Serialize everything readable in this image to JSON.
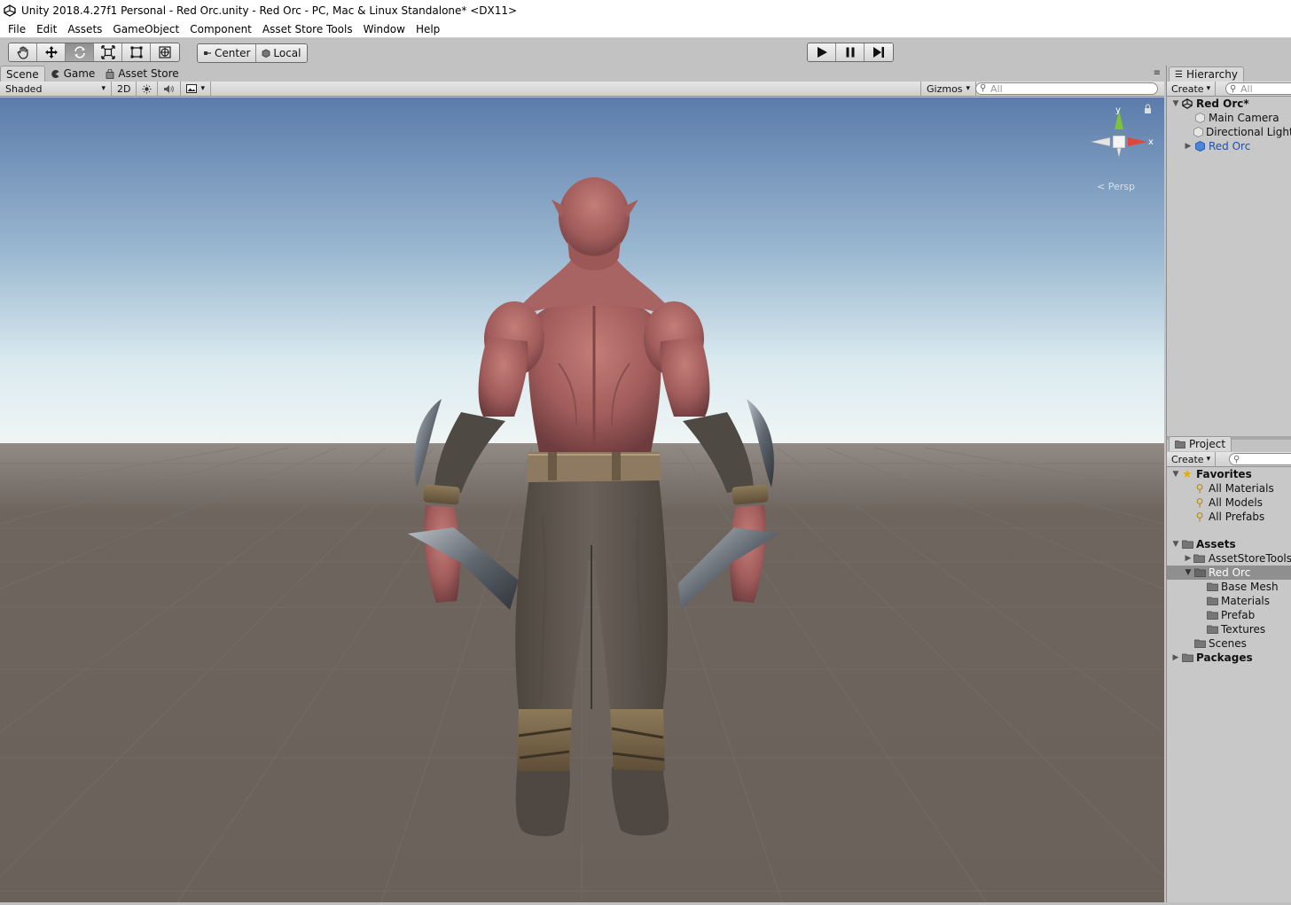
{
  "window": {
    "title": "Unity 2018.4.27f1 Personal - Red Orc.unity - Red Orc - PC, Mac & Linux Standalone* <DX11>"
  },
  "menu": [
    "File",
    "Edit",
    "Assets",
    "GameObject",
    "Component",
    "Asset Store Tools",
    "Window",
    "Help"
  ],
  "toolbar": {
    "tools": [
      "hand-tool",
      "move-tool",
      "rotate-tool",
      "scale-tool",
      "rect-tool",
      "transform-tool"
    ],
    "active_tool": "rotate-tool",
    "pivot_center": "Center",
    "pivot_local": "Local"
  },
  "scene_tabs": [
    "Scene",
    "Game",
    "Asset Store"
  ],
  "scene_controls": {
    "shading_mode": "Shaded",
    "mode_2d": "2D",
    "gizmos_label": "Gizmos",
    "search_placeholder": "All"
  },
  "gizmo": {
    "y_label": "y",
    "x_label": "x",
    "projection": "Persp"
  },
  "hierarchy": {
    "tab_label": "Hierarchy",
    "create_label": "Create",
    "search_placeholder": "All",
    "scene_name": "Red Orc*",
    "items": [
      "Main Camera",
      "Directional Light",
      "Red Orc"
    ]
  },
  "project": {
    "tab_label": "Project",
    "create_label": "Create",
    "favorites_label": "Favorites",
    "favorites": [
      "All Materials",
      "All Models",
      "All Prefabs"
    ],
    "assets_label": "Assets",
    "assets": [
      "AssetStoreTools",
      "Red Orc"
    ],
    "red_orc_children": [
      "Base Mesh",
      "Materials",
      "Prefab",
      "Textures"
    ],
    "scenes_label": "Scenes",
    "packages_label": "Packages"
  },
  "colors": {
    "sky_top": "#5e7fae",
    "sky_horizon": "#e2eef2",
    "ground": "#6b625b",
    "skin": "#b06a68",
    "pants": "#5c544c",
    "link": "#1f4fa8"
  }
}
